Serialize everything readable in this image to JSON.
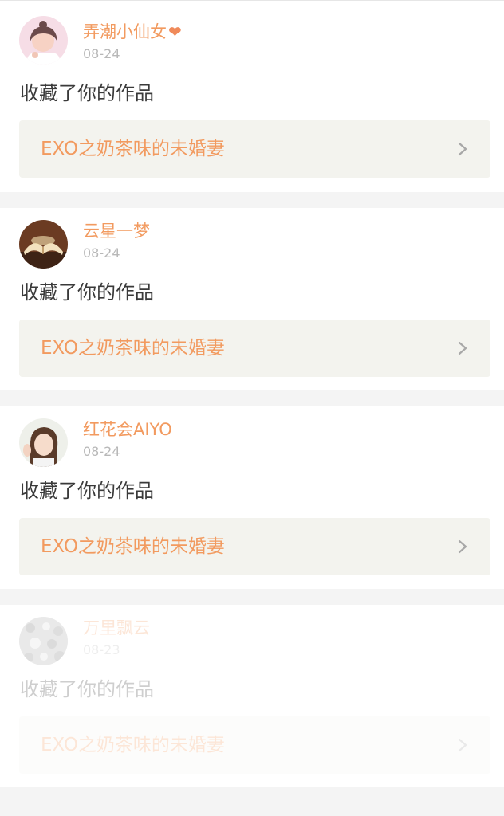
{
  "notifications": [
    {
      "username": "弄潮小仙女",
      "username_suffix_icon": "heart-icon",
      "date": "08-24",
      "action": "收藏了你的作品",
      "work_title": "EXO之奶茶味的未婚妻"
    },
    {
      "username": "云星一梦",
      "date": "08-24",
      "action": "收藏了你的作品",
      "work_title": "EXO之奶茶味的未婚妻"
    },
    {
      "username": "红花会AIYO",
      "date": "08-24",
      "action": "收藏了你的作品",
      "work_title": "EXO之奶茶味的未婚妻"
    },
    {
      "username": "万里飘云",
      "date": "08-23",
      "action": "收藏了你的作品",
      "work_title": "EXO之奶茶味的未婚妻"
    }
  ],
  "colors": {
    "accent": "#f29a5f",
    "date": "#b8b8b8",
    "text": "#3a3a3a",
    "card": "#f3f3ee",
    "separator": "#f4f4f4"
  },
  "icons": {
    "chevron": "chevron-right-icon",
    "heart": "heart-icon"
  }
}
